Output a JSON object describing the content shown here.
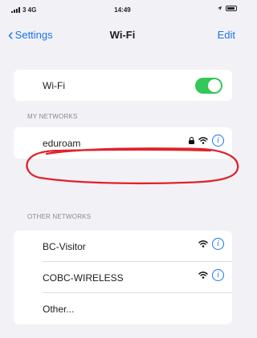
{
  "status_bar": {
    "carrier": "3 4G",
    "time": "14:49"
  },
  "nav": {
    "back_label": "Settings",
    "title": "Wi-Fi",
    "edit_label": "Edit"
  },
  "wifi_toggle": {
    "label": "Wi-Fi",
    "on": true
  },
  "my_networks": {
    "header": "MY NETWORKS",
    "items": [
      {
        "name": "eduroam",
        "secured": true,
        "icons": [
          "lock-icon",
          "wifi-icon",
          "info-icon"
        ]
      }
    ]
  },
  "other_networks": {
    "header": "OTHER NETWORKS",
    "items": [
      {
        "name": "BC-Visitor",
        "icons": [
          "wifi-icon",
          "info-icon"
        ]
      },
      {
        "name": "COBC-WIRELESS",
        "icons": [
          "wifi-icon",
          "info-icon"
        ]
      },
      {
        "name": "Other..."
      }
    ]
  },
  "colors": {
    "accent": "#1a73e8",
    "toggle_on": "#34c759",
    "annotation": "#e0222a",
    "background": "#f2f2f6"
  },
  "icons": {
    "back": "chevron-left-icon",
    "wifi": "wifi-icon",
    "lock": "lock-icon",
    "info": "info-icon"
  }
}
